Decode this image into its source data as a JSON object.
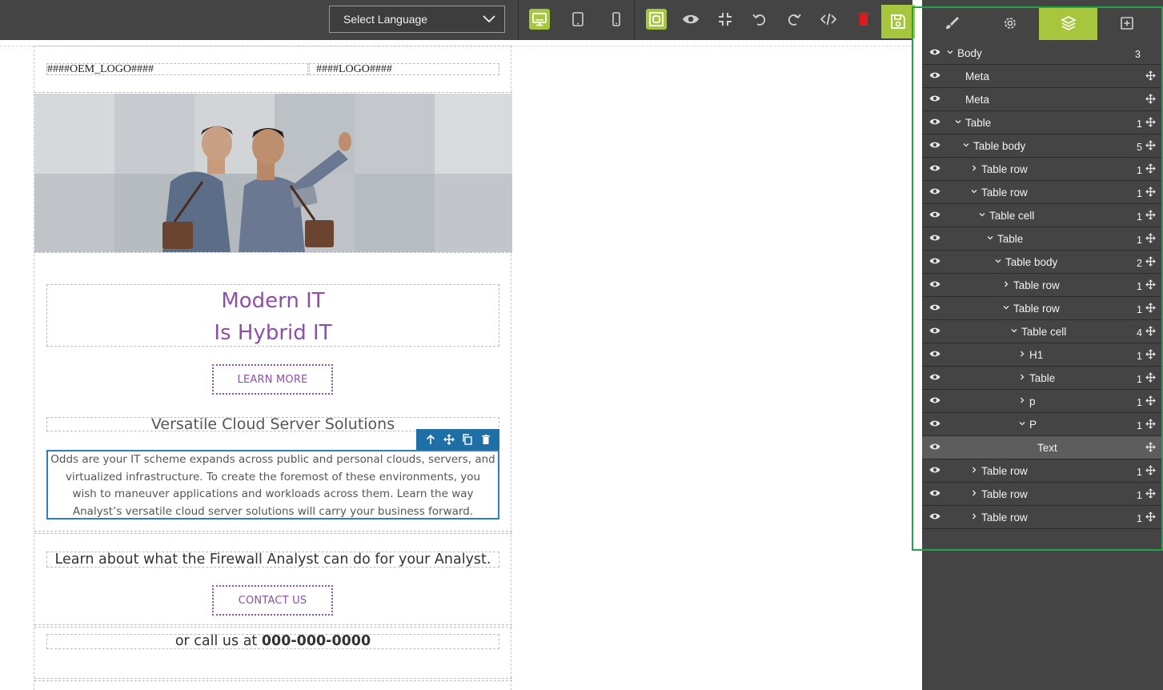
{
  "toolbar": {
    "language_select": "Select Language",
    "buttons": [
      "desktop-view",
      "tablet-view",
      "mobile-view",
      "show-borders",
      "preview",
      "fullscreen-exit",
      "undo",
      "redo",
      "code-view",
      "delete",
      "save"
    ],
    "accent_color": "#a8c63d"
  },
  "email": {
    "oem_logo": "####OEM_LOGO####",
    "logo": "####LOGO####",
    "headline_line1": "Modern IT",
    "headline_line2": "Is Hybrid IT",
    "learn_more": "LEARN MORE",
    "subheading": "Versatile Cloud Server Solutions",
    "body_line1": "Odds are your IT scheme expands across public and personal clouds, servers, and",
    "body_line2": "virtualized infrastructure. To create the foremost of these environments, you",
    "body_line3": "wish to maneuver applications and workloads across them. Learn the way",
    "body_line4": "Analyst’s versatile cloud server solutions will carry your business forward.",
    "learn_about": "Learn about what the Firewall Analyst can do for your Analyst.",
    "contact_us": "CONTACT US",
    "call_prefix": "or call us at ",
    "phone": "000-000-0000",
    "accent_color": "#8e4fa6"
  },
  "panel": {
    "tabs": [
      "style-manager",
      "settings",
      "layer-manager",
      "blocks"
    ],
    "active_tab": "layer-manager",
    "layers": [
      {
        "name": "Body",
        "count": "3",
        "caret": "down",
        "indent": 0,
        "move": false
      },
      {
        "name": "Meta",
        "count": "",
        "caret": "none",
        "indent": 1,
        "move": true
      },
      {
        "name": "Meta",
        "count": "",
        "caret": "none",
        "indent": 1,
        "move": true
      },
      {
        "name": "Table",
        "count": "1",
        "caret": "down",
        "indent": 1,
        "move": true
      },
      {
        "name": "Table body",
        "count": "5",
        "caret": "down",
        "indent": 2,
        "move": true
      },
      {
        "name": "Table row",
        "count": "1",
        "caret": "right",
        "indent": 3,
        "move": true
      },
      {
        "name": "Table row",
        "count": "1",
        "caret": "down",
        "indent": 3,
        "move": true
      },
      {
        "name": "Table cell",
        "count": "1",
        "caret": "down",
        "indent": 4,
        "move": true
      },
      {
        "name": "Table",
        "count": "1",
        "caret": "down",
        "indent": 5,
        "move": true
      },
      {
        "name": "Table body",
        "count": "2",
        "caret": "down",
        "indent": 6,
        "move": true
      },
      {
        "name": "Table row",
        "count": "1",
        "caret": "right",
        "indent": 7,
        "move": true
      },
      {
        "name": "Table row",
        "count": "1",
        "caret": "down",
        "indent": 7,
        "move": true
      },
      {
        "name": "Table cell",
        "count": "4",
        "caret": "down",
        "indent": 8,
        "move": true
      },
      {
        "name": "H1",
        "count": "1",
        "caret": "right",
        "indent": 9,
        "move": true
      },
      {
        "name": "Table",
        "count": "1",
        "caret": "right",
        "indent": 9,
        "move": true
      },
      {
        "name": "p",
        "count": "1",
        "caret": "right",
        "indent": 9,
        "move": true
      },
      {
        "name": "P",
        "count": "1",
        "caret": "down",
        "indent": 9,
        "move": true
      },
      {
        "name": "Text",
        "count": "",
        "caret": "none",
        "indent": 10,
        "move": true,
        "selected": true
      },
      {
        "name": "Table row",
        "count": "1",
        "caret": "right",
        "indent": 3,
        "move": true
      },
      {
        "name": "Table row",
        "count": "1",
        "caret": "right",
        "indent": 3,
        "move": true
      },
      {
        "name": "Table row",
        "count": "1",
        "caret": "right",
        "indent": 3,
        "move": true
      }
    ]
  }
}
